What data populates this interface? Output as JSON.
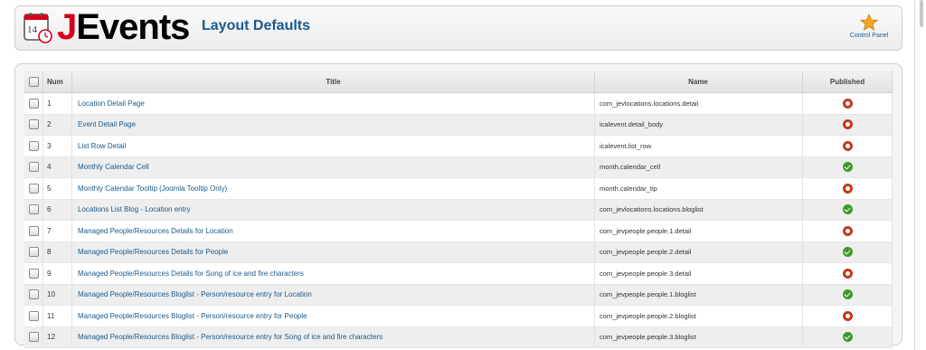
{
  "header": {
    "logo_text_j": "J",
    "logo_text_rest": "Events",
    "calendar_number": "14",
    "page_title": "Layout Defaults",
    "control_panel_label": "Control Panel",
    "icons": {
      "logo": "calendar-clock-icon",
      "control_panel": "star-icon"
    }
  },
  "table": {
    "columns": {
      "num": "Num",
      "title": "Title",
      "name": "Name",
      "published": "Published"
    },
    "rows": [
      {
        "num": "1",
        "title": "Location Detail Page",
        "name": "com_jevlocations.locations.detail",
        "published": false
      },
      {
        "num": "2",
        "title": "Event Detail Page",
        "name": "icalevent.detail_body",
        "published": false
      },
      {
        "num": "3",
        "title": "List Row Detail",
        "name": "icalevent.list_row",
        "published": false
      },
      {
        "num": "4",
        "title": "Monthly Calendar Cell",
        "name": "month.calendar_cell",
        "published": true
      },
      {
        "num": "5",
        "title": "Monthly Calendar Tooltip (Joomla Tooltip Only)",
        "name": "month.calendar_tip",
        "published": false
      },
      {
        "num": "6",
        "title": "Locations List Blog - Location entry",
        "name": "com_jevlocations.locations.bloglist",
        "published": true
      },
      {
        "num": "7",
        "title": "Managed People/Resources Details for Location",
        "name": "com_jevpeople.people.1.detail",
        "published": false
      },
      {
        "num": "8",
        "title": "Managed People/Resources Details for People",
        "name": "com_jevpeople.people.2.detail",
        "published": true
      },
      {
        "num": "9",
        "title": "Managed People/Resources Details for Song of ice and fire characters",
        "name": "com_jevpeople.people.3.detail",
        "published": false
      },
      {
        "num": "10",
        "title": "Managed People/Resources Bloglist - Person/resource entry for Location",
        "name": "com_jevpeople.people.1.bloglist",
        "published": true
      },
      {
        "num": "11",
        "title": "Managed People/Resources Bloglist - Person/resource entry for People",
        "name": "com_jevpeople.people.2.bloglist",
        "published": false
      },
      {
        "num": "12",
        "title": "Managed People/Resources Bloglist - Person/resource entry for Song of ice and fire characters",
        "name": "com_jevpeople.people.3.bloglist",
        "published": true
      }
    ]
  },
  "colors": {
    "brand_red": "#d5001c",
    "link_blue": "#1a5a8c",
    "published_green": "#3d9a2a",
    "unpublished_red": "#c13a1c"
  }
}
